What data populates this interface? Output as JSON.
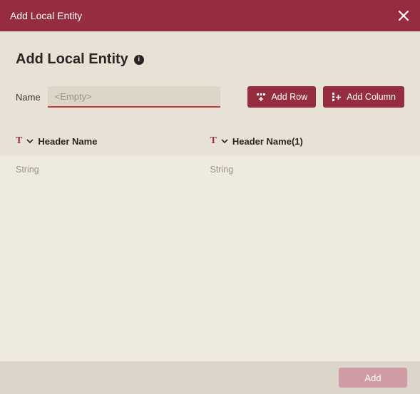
{
  "titlebar": {
    "title": "Add Local Entity"
  },
  "heading": "Add Local Entity",
  "name_field": {
    "label": "Name",
    "placeholder": "<Empty>",
    "value": ""
  },
  "buttons": {
    "add_row": "Add Row",
    "add_column": "Add Column"
  },
  "table": {
    "columns": [
      {
        "type": "T",
        "label": "Header Name"
      },
      {
        "type": "T",
        "label": "Header Name(1)"
      }
    ],
    "rows": [
      {
        "cells": [
          "String",
          "String"
        ]
      }
    ]
  },
  "footer": {
    "add": "Add"
  }
}
